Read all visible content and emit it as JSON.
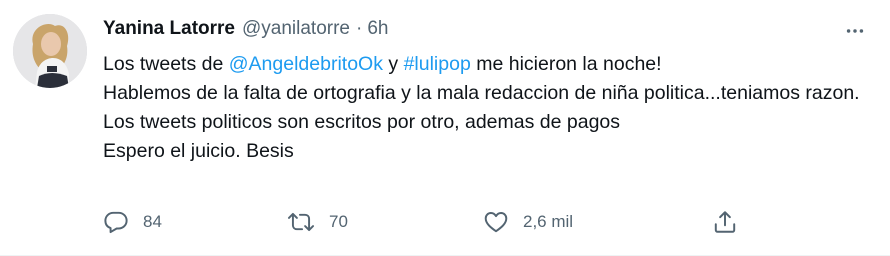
{
  "user": {
    "display_name": "Yanina Latorre",
    "handle": "@yanilatorre",
    "separator": "·",
    "time": "6h"
  },
  "tweet": {
    "line1": {
      "before": "Los tweets de ",
      "mention": "@AngeldebritoOk",
      "middle": " y ",
      "hashtag": "#lulipop",
      "after": " me hicieron la noche!"
    },
    "paragraph2": "Hablemos de la falta de ortografia y la mala redaccion de niña politica...teniamos razon. Los tweets politicos son escritos por otro, ademas de pagos",
    "paragraph3": "Espero el juicio. Besis"
  },
  "actions": {
    "reply_count": "84",
    "retweet_count": "70",
    "like_count": "2,6 mil"
  },
  "colors": {
    "link": "#1d9bf0",
    "text": "#0f1419",
    "secondary": "#536471"
  },
  "icons": {
    "more": "more-dots-icon",
    "reply": "reply-bubble-icon",
    "retweet": "retweet-arrows-icon",
    "like": "heart-icon",
    "share": "share-upload-icon"
  }
}
